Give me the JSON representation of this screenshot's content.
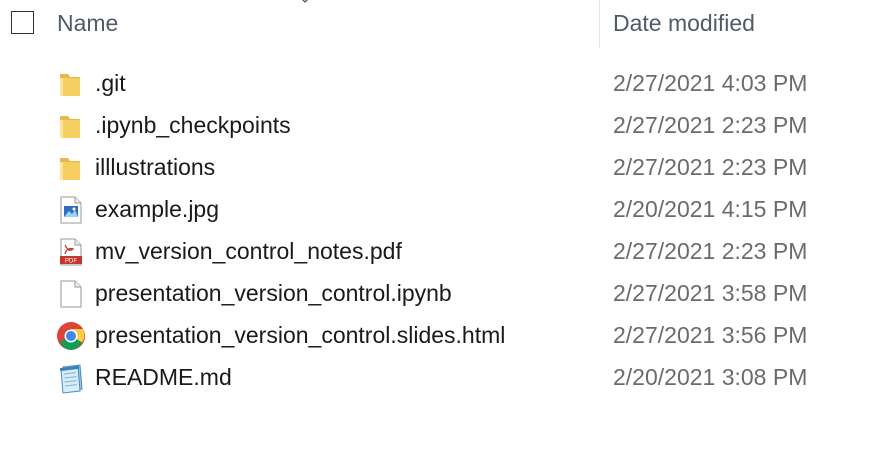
{
  "header": {
    "name_label": "Name",
    "date_label": "Date modified"
  },
  "files": [
    {
      "name": ".git",
      "date": "2/27/2021 4:03 PM",
      "icon": "folder-icon"
    },
    {
      "name": ".ipynb_checkpoints",
      "date": "2/27/2021 2:23 PM",
      "icon": "folder-icon"
    },
    {
      "name": "illlustrations",
      "date": "2/27/2021 2:23 PM",
      "icon": "folder-icon"
    },
    {
      "name": "example.jpg",
      "date": "2/20/2021 4:15 PM",
      "icon": "image-file-icon"
    },
    {
      "name": "mv_version_control_notes.pdf",
      "date": "2/27/2021 2:23 PM",
      "icon": "pdf-file-icon"
    },
    {
      "name": "presentation_version_control.ipynb",
      "date": "2/27/2021 3:58 PM",
      "icon": "generic-file-icon"
    },
    {
      "name": "presentation_version_control.slides.html",
      "date": "2/27/2021 3:56 PM",
      "icon": "chrome-html-icon"
    },
    {
      "name": "README.md",
      "date": "2/20/2021 3:08 PM",
      "icon": "notepad-file-icon"
    }
  ],
  "colors": {
    "folder": "#f6cf63",
    "header_text": "#4f5b66",
    "date_text": "#6b6b6b",
    "pdf_red": "#c8342a"
  },
  "icons": {
    "pdf_badge": "PDF"
  }
}
